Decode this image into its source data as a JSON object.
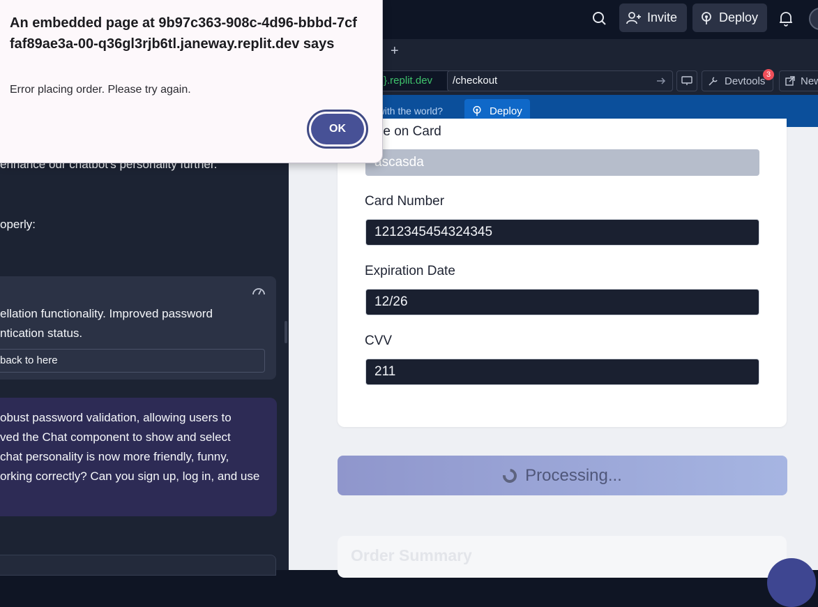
{
  "dialog": {
    "title": "An embedded page at 9b97c363-908c-4d96-bbbd-7cffaf89ae3a-00-q36gl3rjb6tl.janeway.replit.dev says",
    "message": "Error placing order. Please try again.",
    "ok_label": "OK"
  },
  "topbar": {
    "invite_label": "Invite",
    "deploy_label": "Deploy"
  },
  "browser": {
    "domain": "}.replit.dev",
    "path": "/checkout",
    "devtools_label": "Devtools",
    "devtools_badge": "3",
    "new_tab_label": "New"
  },
  "banner": {
    "text": "e with the world?",
    "deploy_label": "Deploy"
  },
  "chat": {
    "line_1": "enhance our chatbot's personality further.",
    "line_2": "operly:",
    "checkpoint_line_1": "ellation functionality. Improved password",
    "checkpoint_line_2": "ntication status.",
    "rollback_label": "back to here",
    "agent_lines": [
      "obust password validation, allowing users to",
      "ved the Chat component to show and select",
      "chat personality is now more friendly, funny,",
      "orking correctly? Can you sign up, log in, and use"
    ]
  },
  "checkout": {
    "name_label": "ame on Card",
    "name_value": "ascasda",
    "card_label": "Card Number",
    "card_value": "1212345454324345",
    "exp_label": "Expiration Date",
    "exp_value": "12/26",
    "cvv_label": "CVV",
    "cvv_value": "211",
    "processing_label": "Processing...",
    "summary_title": "Order Summary"
  },
  "colors": {
    "banner": "#0b4f9b",
    "dialog_button": "#475196",
    "processing_gradient_start": "#8f96cc",
    "processing_gradient_end": "#a6b5e2"
  }
}
